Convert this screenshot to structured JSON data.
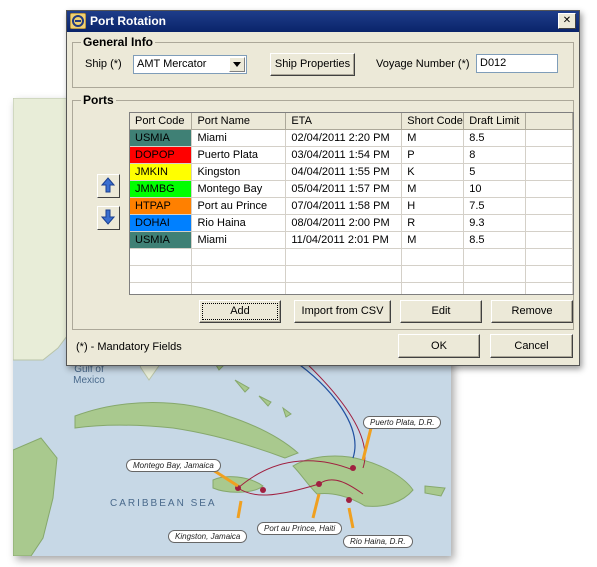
{
  "window": {
    "title": "Port Rotation",
    "close_label": "✕"
  },
  "general_info": {
    "legend": "General Info",
    "ship_label": "Ship (*)",
    "ship_value": "AMT Mercator",
    "ship_properties_button": "Ship Properties",
    "voyage_label": "Voyage Number (*)",
    "voyage_value": "D012"
  },
  "ports": {
    "legend": "Ports",
    "columns": [
      "Port Code",
      "Port Name",
      "ETA",
      "Short Code",
      "Draft Limit"
    ],
    "rows": [
      {
        "code": "USMIA",
        "color": "#3f8075",
        "name": "Miami",
        "eta": "02/04/2011 2:20 PM",
        "short": "M",
        "draft": "8.5"
      },
      {
        "code": "DOPOP",
        "color": "#ff0000",
        "name": "Puerto Plata",
        "eta": "03/04/2011 1:54 PM",
        "short": "P",
        "draft": "8"
      },
      {
        "code": "JMKIN",
        "color": "#ffff00",
        "name": "Kingston",
        "eta": "04/04/2011 1:55 PM",
        "short": "K",
        "draft": "5"
      },
      {
        "code": "JMMBG",
        "color": "#00ff00",
        "name": "Montego Bay",
        "eta": "05/04/2011 1:57 PM",
        "short": "M",
        "draft": "10"
      },
      {
        "code": "HTPAP",
        "color": "#ff8000",
        "name": "Port au Prince",
        "eta": "07/04/2011 1:58 PM",
        "short": "H",
        "draft": "7.5"
      },
      {
        "code": "DOHAI",
        "color": "#0080ff",
        "name": "Rio Haina",
        "eta": "08/04/2011 2:00 PM",
        "short": "R",
        "draft": "9.3"
      },
      {
        "code": "USMIA",
        "color": "#3f8075",
        "name": "Miami",
        "eta": "11/04/2011 2:01 PM",
        "short": "M",
        "draft": "8.5"
      }
    ],
    "add_button": "Add",
    "import_button": "Import from CSV",
    "edit_button": "Edit",
    "remove_button": "Remove"
  },
  "footer": {
    "mandatory_note": "(*) - Mandatory Fields",
    "ok_button": "OK",
    "cancel_button": "Cancel"
  },
  "map": {
    "gulf_label": "Gulf of Mexico",
    "sea_label": "CARIBBEAN SEA",
    "callouts": {
      "puerto_plata": "Puerto Plata, D.R.",
      "montego_bay": "Montego Bay, Jamaica",
      "kingston": "Kingston, Jamaica",
      "port_au_prince": "Port au Prince, Haiti",
      "rio_haina": "Rio Haina, D.R."
    }
  }
}
